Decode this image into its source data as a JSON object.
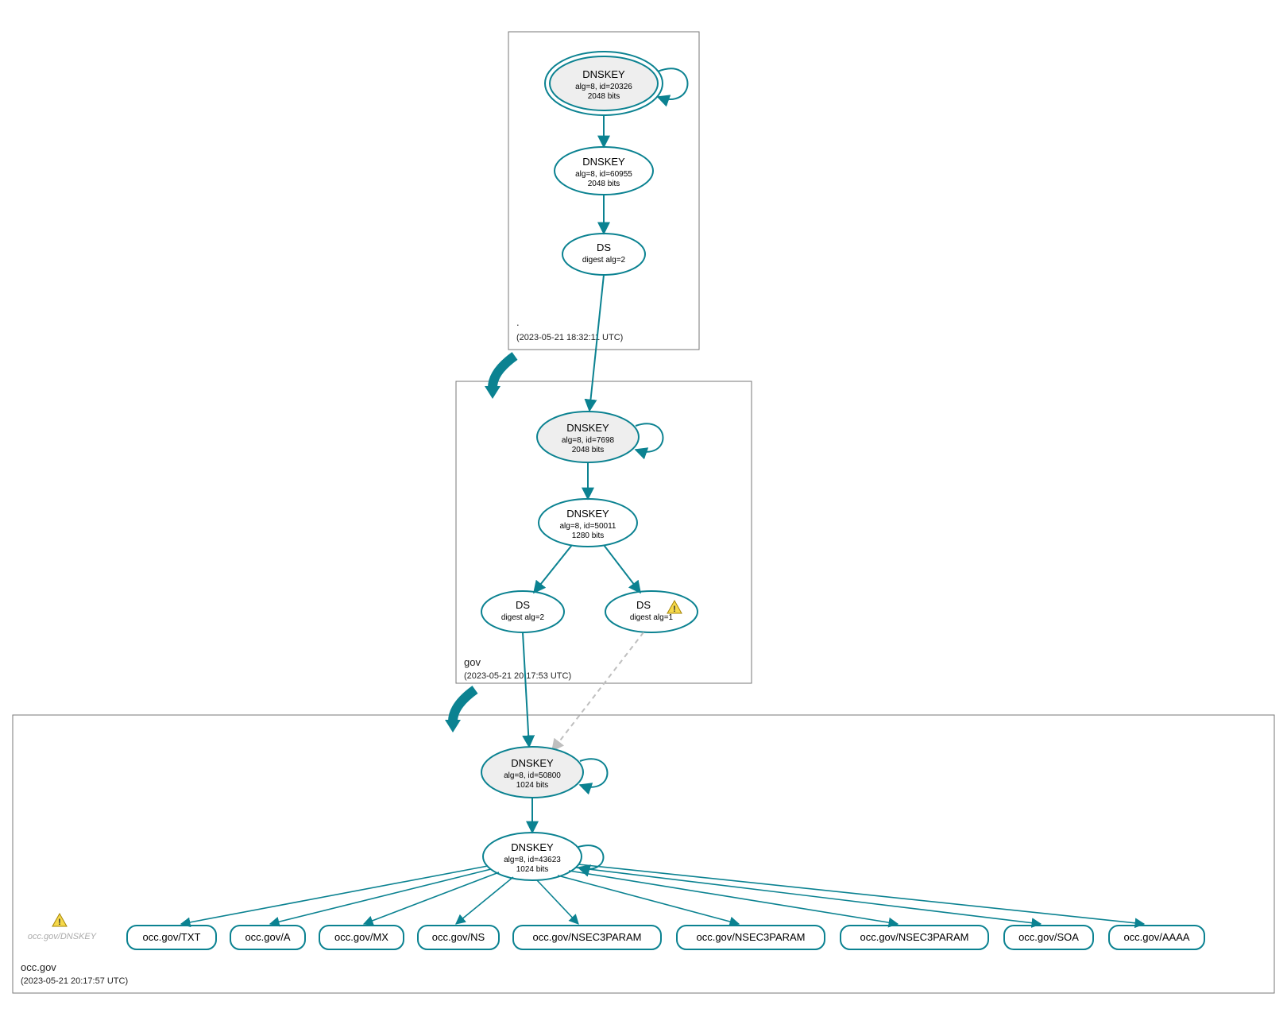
{
  "colors": {
    "teal": "#0b8291",
    "grey": "#d5d5d5",
    "lightgrey": "#eeeeee",
    "warn": "#f6d94a",
    "dashed": "#bfbfbf"
  },
  "zones": {
    "root": {
      "label": ".",
      "timestamp": "(2023-05-21 18:32:11 UTC)"
    },
    "gov": {
      "label": "gov",
      "timestamp": "(2023-05-21 20:17:53 UTC)"
    },
    "occgov": {
      "label": "occ.gov",
      "timestamp": "(2023-05-21 20:17:57 UTC)"
    }
  },
  "nodes": {
    "root_ksk": {
      "title": "DNSKEY",
      "line2": "alg=8, id=20326",
      "line3": "2048 bits"
    },
    "root_zsk": {
      "title": "DNSKEY",
      "line2": "alg=8, id=60955",
      "line3": "2048 bits"
    },
    "root_ds": {
      "title": "DS",
      "line2": "digest alg=2"
    },
    "gov_ksk": {
      "title": "DNSKEY",
      "line2": "alg=8, id=7698",
      "line3": "2048 bits"
    },
    "gov_zsk": {
      "title": "DNSKEY",
      "line2": "alg=8, id=50011",
      "line3": "1280 bits"
    },
    "gov_ds1": {
      "title": "DS",
      "line2": "digest alg=2"
    },
    "gov_ds2": {
      "title": "DS",
      "line2": "digest alg=1"
    },
    "occ_ksk": {
      "title": "DNSKEY",
      "line2": "alg=8, id=50800",
      "line3": "1024 bits"
    },
    "occ_zsk": {
      "title": "DNSKEY",
      "line2": "alg=8, id=43623",
      "line3": "1024 bits"
    },
    "occ_txt": {
      "title": "occ.gov/TXT"
    },
    "occ_a": {
      "title": "occ.gov/A"
    },
    "occ_mx": {
      "title": "occ.gov/MX"
    },
    "occ_ns": {
      "title": "occ.gov/NS"
    },
    "occ_nsec3a": {
      "title": "occ.gov/NSEC3PARAM"
    },
    "occ_nsec3b": {
      "title": "occ.gov/NSEC3PARAM"
    },
    "occ_nsec3c": {
      "title": "occ.gov/NSEC3PARAM"
    },
    "occ_soa": {
      "title": "occ.gov/SOA"
    },
    "occ_aaaa": {
      "title": "occ.gov/AAAA"
    },
    "standalone_warn_label": "occ.gov/DNSKEY"
  }
}
